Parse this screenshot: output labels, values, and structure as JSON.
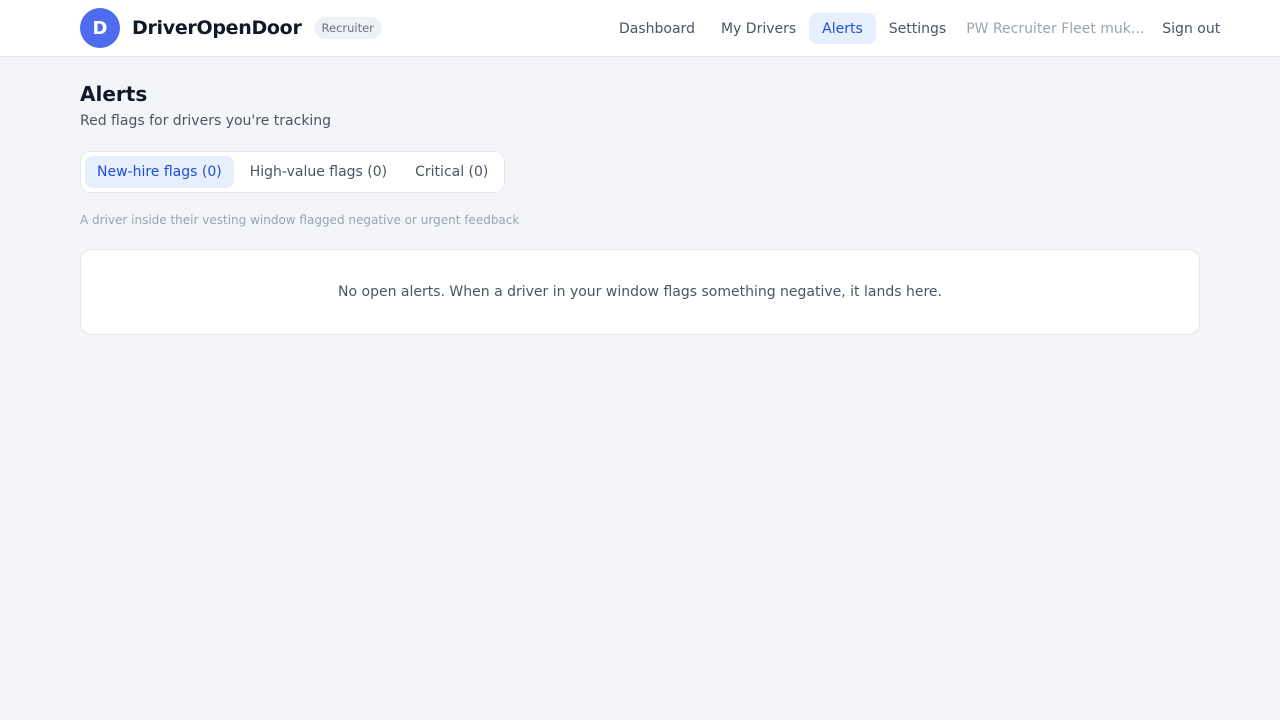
{
  "brand": {
    "logo_letter": "D",
    "name": "DriverOpenDoor",
    "role_badge": "Recruiter"
  },
  "nav": {
    "items": [
      {
        "label": "Dashboard",
        "active": false
      },
      {
        "label": "My Drivers",
        "active": false
      },
      {
        "label": "Alerts",
        "active": true
      },
      {
        "label": "Settings",
        "active": false
      }
    ],
    "user_label": "PW Recruiter Fleet muk...",
    "sign_out": "Sign out"
  },
  "page": {
    "title": "Alerts",
    "subtitle": "Red flags for drivers you're tracking"
  },
  "tabs": [
    {
      "label": "New-hire flags (0)",
      "active": true
    },
    {
      "label": "High-value flags (0)",
      "active": false
    },
    {
      "label": "Critical (0)",
      "active": false
    }
  ],
  "tab_description": "A driver inside their vesting window flagged negative or urgent feedback",
  "empty_state": {
    "message": "No open alerts. When a driver in your window flags something negative, it lands here."
  },
  "colors": {
    "accent": "#1d4ed8",
    "logo_bg": "#4f6cf0",
    "active_bg": "#e8effc",
    "page_bg": "#f3f5f9"
  }
}
